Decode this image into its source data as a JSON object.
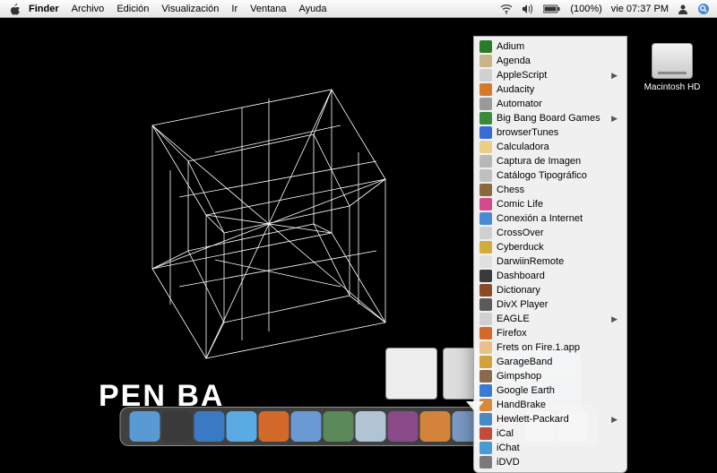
{
  "menubar": {
    "app": "Finder",
    "items": [
      "Archivo",
      "Edición",
      "Visualización",
      "Ir",
      "Ventana",
      "Ayuda"
    ],
    "battery": "(100%)",
    "clock": "vie 07:37 PM"
  },
  "hd": {
    "label": "Macintosh HD"
  },
  "logo": "PEN  BA",
  "apps": [
    {
      "name": "Adium",
      "color": "#2a7a2a",
      "sub": false
    },
    {
      "name": "Agenda",
      "color": "#c9b48a",
      "sub": false
    },
    {
      "name": "AppleScript",
      "color": "#d0d0d0",
      "sub": true
    },
    {
      "name": "Audacity",
      "color": "#d47a2a",
      "sub": false
    },
    {
      "name": "Automator",
      "color": "#9a9a9a",
      "sub": false
    },
    {
      "name": "Big Bang Board Games",
      "color": "#3a8a3a",
      "sub": true
    },
    {
      "name": "browserTunes",
      "color": "#3a6ad4",
      "sub": false
    },
    {
      "name": "Calculadora",
      "color": "#e8d088",
      "sub": false
    },
    {
      "name": "Captura de Imagen",
      "color": "#b8b8b8",
      "sub": false
    },
    {
      "name": "Catálogo Tipográfico",
      "color": "#c0c0c0",
      "sub": false
    },
    {
      "name": "Chess",
      "color": "#8a6a3a",
      "sub": false
    },
    {
      "name": "Comic Life",
      "color": "#d44a8a",
      "sub": false
    },
    {
      "name": "Conexión a Internet",
      "color": "#4a8ad4",
      "sub": false
    },
    {
      "name": "CrossOver",
      "color": "#d0d0d0",
      "sub": false
    },
    {
      "name": "Cyberduck",
      "color": "#d4aa3a",
      "sub": false
    },
    {
      "name": "DarwiinRemote",
      "color": "#e0e0e0",
      "sub": false
    },
    {
      "name": "Dashboard",
      "color": "#3a3a3a",
      "sub": false
    },
    {
      "name": "Dictionary",
      "color": "#8a4a2a",
      "sub": false
    },
    {
      "name": "DivX Player",
      "color": "#5a5a5a",
      "sub": false
    },
    {
      "name": "EAGLE",
      "color": "#d0d0d0",
      "sub": true
    },
    {
      "name": "Firefox",
      "color": "#d46a2a",
      "sub": false
    },
    {
      "name": "Frets on Fire.1.app",
      "color": "#e8c088",
      "sub": false
    },
    {
      "name": "GarageBand",
      "color": "#d4a03a",
      "sub": false
    },
    {
      "name": "Gimpshop",
      "color": "#8a6a4a",
      "sub": false
    },
    {
      "name": "Google Earth",
      "color": "#3a7ad4",
      "sub": false
    },
    {
      "name": "HandBrake",
      "color": "#d48a3a",
      "sub": false
    },
    {
      "name": "Hewlett-Packard",
      "color": "#4a8ac4",
      "sub": true
    },
    {
      "name": "iCal",
      "color": "#c44a3a",
      "sub": false
    },
    {
      "name": "iChat",
      "color": "#4a9ad4",
      "sub": false
    },
    {
      "name": "iDVD",
      "color": "#7a7a7a",
      "sub": false
    }
  ],
  "dock": [
    {
      "name": "finder",
      "color": "#5a9ad4"
    },
    {
      "name": "dashboard",
      "color": "#3a3a3a"
    },
    {
      "name": "google-earth",
      "color": "#3a7ac4"
    },
    {
      "name": "ichat",
      "color": "#5aaae4"
    },
    {
      "name": "firefox",
      "color": "#d46a2a"
    },
    {
      "name": "safari",
      "color": "#6a9ad4"
    },
    {
      "name": "itunes",
      "color": "#5a8a5a"
    },
    {
      "name": "mail",
      "color": "#b0c4d4"
    },
    {
      "name": "app1",
      "color": "#8a4a8a"
    },
    {
      "name": "app2",
      "color": "#d4843a"
    },
    {
      "name": "preview",
      "color": "#7a9ac4"
    },
    {
      "name": "photobooth",
      "color": "#a44a3a"
    },
    {
      "name": "app3",
      "color": "#d0d0d0"
    },
    {
      "name": "app4",
      "color": "#b0b0b0"
    }
  ]
}
